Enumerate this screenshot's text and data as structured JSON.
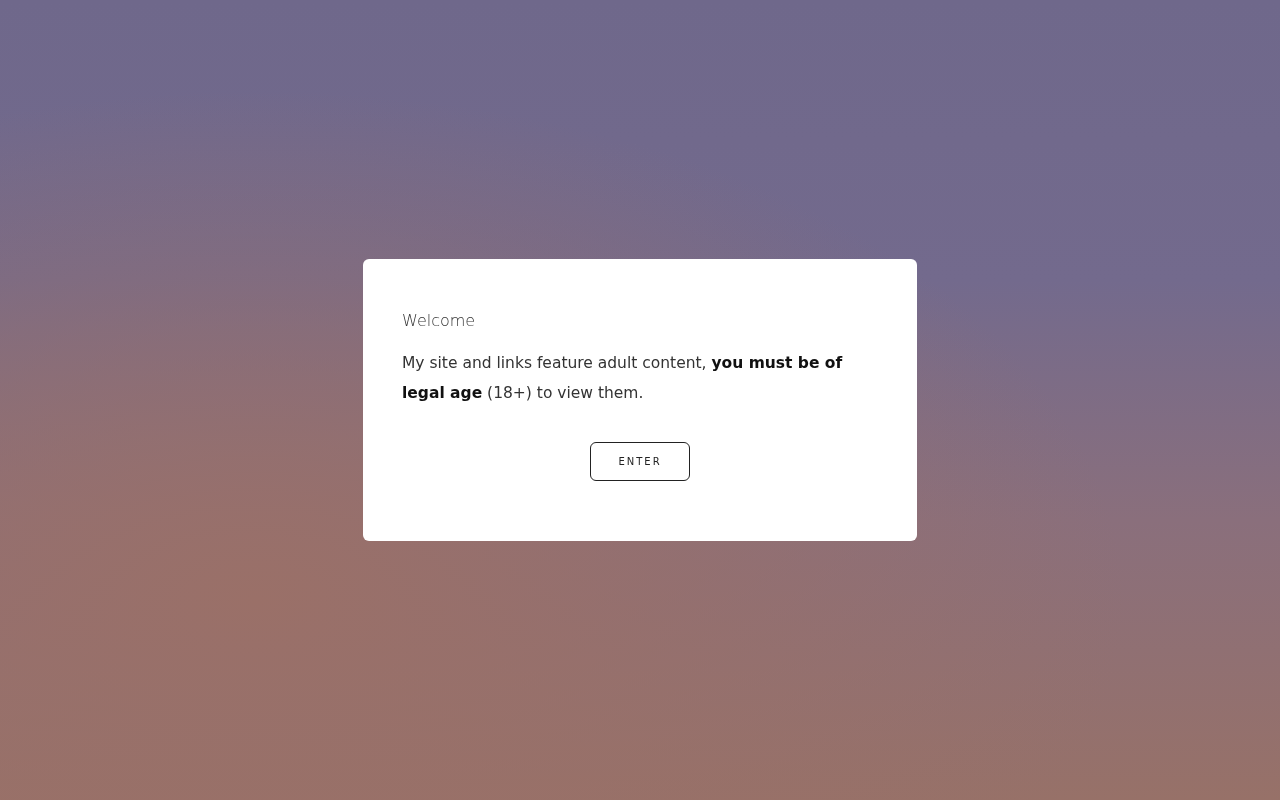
{
  "dialog": {
    "title": "Welcome",
    "message": "My site and links feature adult content, **you must be of legal age** (18+) to view them.",
    "button": "ENTER"
  }
}
